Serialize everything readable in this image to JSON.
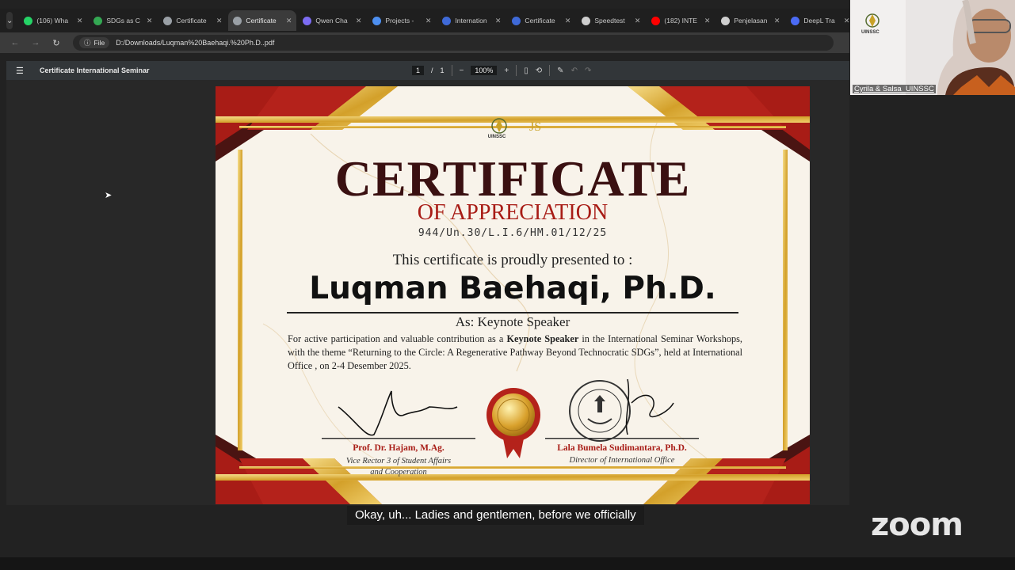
{
  "browser": {
    "tabs": [
      {
        "label": "(106) Wha",
        "favicon_color": "#25d366"
      },
      {
        "label": "SDGs as C",
        "favicon_color": "#34a853"
      },
      {
        "label": "Certificate",
        "favicon_color": "#9aa0a6"
      },
      {
        "label": "Certificate",
        "favicon_color": "#9aa0a6",
        "active": true
      },
      {
        "label": "Qwen Cha",
        "favicon_color": "#7c6cf2"
      },
      {
        "label": "Projects -",
        "favicon_color": "#4d8ff0"
      },
      {
        "label": "Internation",
        "favicon_color": "#3f6ad8"
      },
      {
        "label": "Certificate",
        "favicon_color": "#3f6ad8"
      },
      {
        "label": "Speedtest",
        "favicon_color": "#cfcfcf"
      },
      {
        "label": "(182) INTE",
        "favicon_color": "#ff0000"
      },
      {
        "label": "Penjelasan",
        "favicon_color": "#cfcfcf"
      },
      {
        "label": "DeepL Tra",
        "favicon_color": "#4b6bf5"
      }
    ],
    "address": {
      "scheme_label": "File",
      "url": "D:/Downloads/Luqman%20Baehaqi.%20Ph.D..pdf"
    }
  },
  "pdf_toolbar": {
    "title": "Certificate International Seminar",
    "page_current": "1",
    "page_separator": "/",
    "page_total": "1",
    "zoom": "100%"
  },
  "certificate": {
    "logo_text": "UINSSC",
    "title": "CERTIFICATE",
    "subtitle": "OF APPRECIATION",
    "number": "944/Un.30/L.I.6/HM.01/12/25",
    "presented_to": "This certificate is proudly presented to :",
    "recipient": "Luqman Baehaqi, Ph.D.",
    "role": "As: Keynote Speaker",
    "body_pre": "For active participation and valuable contribution as a ",
    "body_bold": "Keynote Speaker",
    "body_post": " in the International Seminar Workshops, with the theme “Returning to the Circle: A Regenerative Pathway Beyond Technocratic SDGs”, held at International Office , on 2-4 Desember 2025.",
    "signer_left_name": "Prof. Dr. Hajam, M.Ag.",
    "signer_left_title_1": "Vice Rector 3 of Student Affairs",
    "signer_left_title_2": "and Cooperation",
    "signer_right_name": "Lala Bumela Sudimantara, Ph.D.",
    "signer_right_title": "Director of International Office",
    "colors": {
      "maroon": "#a81c16",
      "gold": "#d6a52d",
      "dark_red": "#4a1412"
    }
  },
  "meeting": {
    "participant_name": "Cyrila & Salsa_UINSSC",
    "video_logo": "UINSSC",
    "subtitle": "Okay, uh... Ladies and gentlemen, before we officially",
    "brand": "zoom"
  }
}
